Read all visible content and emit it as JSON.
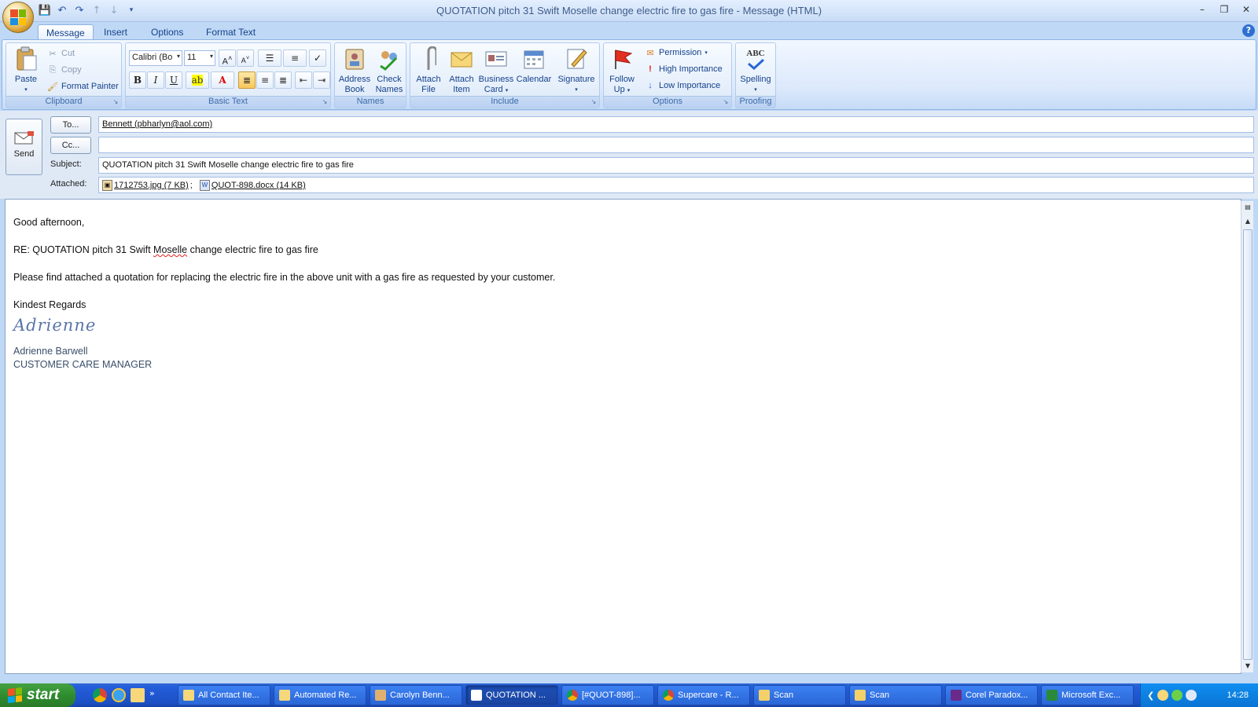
{
  "window": {
    "title": "QUOTATION pitch 31 Swift Moselle change electric fire to gas fire - Message (HTML)"
  },
  "ribbon_tabs": [
    "Message",
    "Insert",
    "Options",
    "Format Text"
  ],
  "ribbon": {
    "clipboard": {
      "label": "Clipboard",
      "paste": "Paste",
      "cut": "Cut",
      "copy": "Copy",
      "format_painter": "Format Painter"
    },
    "basic_text": {
      "label": "Basic Text",
      "font": "Calibri (Bo",
      "size": "11",
      "bold": "B",
      "italic": "I",
      "underline": "U",
      "grow": "A",
      "shrink": "A"
    },
    "names": {
      "label": "Names",
      "address_book_1": "Address",
      "address_book_2": "Book",
      "check_names_1": "Check",
      "check_names_2": "Names"
    },
    "include": {
      "label": "Include",
      "attach_file_1": "Attach",
      "attach_file_2": "File",
      "attach_item_1": "Attach",
      "attach_item_2": "Item",
      "business_card_1": "Business",
      "business_card_2": "Card",
      "calendar": "Calendar",
      "signature": "Signature"
    },
    "options": {
      "label": "Options",
      "follow_up_1": "Follow",
      "follow_up_2": "Up",
      "permission": "Permission",
      "high_importance": "High Importance",
      "low_importance": "Low Importance"
    },
    "proofing": {
      "label": "Proofing",
      "spelling": "Spelling",
      "abc": "ABC"
    }
  },
  "header": {
    "send": "Send",
    "to_button": "To...",
    "cc_button": "Cc...",
    "subject_label": "Subject:",
    "attached_label": "Attached:",
    "to_value": "Bennett (pbharlyn@aol.com)",
    "cc_value": "",
    "subject_value": "QUOTATION pitch 31 Swift Moselle change electric fire to gas fire",
    "attachments": [
      "1712753.jpg (7 KB)",
      "QUOT-898.docx (14 KB)"
    ],
    "attachment_sep": ";"
  },
  "body": {
    "greeting": "Good afternoon,",
    "re_prefix": "RE: QUOTATION pitch 31 Swift ",
    "re_misspelled": "Moselle",
    "re_suffix": " change electric fire to gas fire",
    "paragraph": "Please find attached a quotation for replacing the electric fire in the above unit with a gas fire as requested by your customer.",
    "closing": "Kindest Regards",
    "signature_script": "Adrienne",
    "name": "Adrienne Barwell",
    "role": "CUSTOMER CARE MANAGER"
  },
  "taskbar": {
    "start": "start",
    "tasks": [
      "All Contact Ite...",
      "Automated Re...",
      "Carolyn Benn...",
      "QUOTATION ...",
      "[#QUOT-898]...",
      "Supercare - R...",
      "Scan",
      "Scan",
      "Corel Paradox...",
      "Microsoft Exc..."
    ],
    "clock": "14:28"
  },
  "colors": {
    "ribbon_bg": "#dce9fb",
    "taskbar": "#245edb",
    "start_green": "#2f8c2f",
    "signature_blue": "#5a75a8"
  }
}
